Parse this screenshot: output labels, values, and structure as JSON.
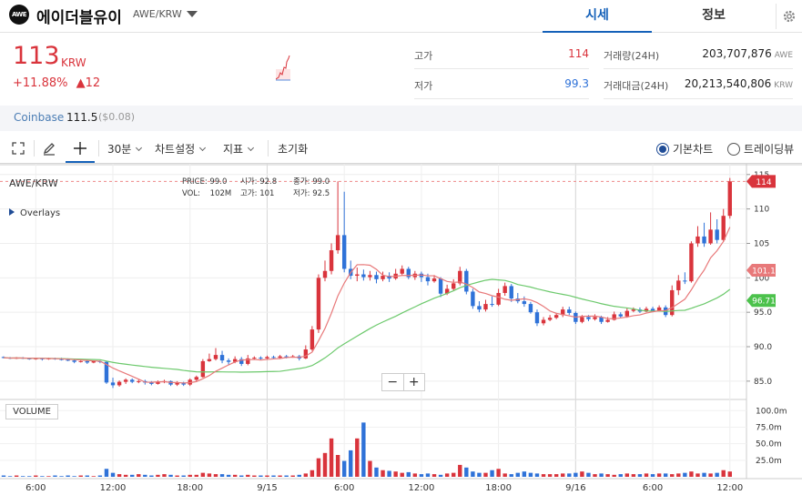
{
  "header": {
    "logo_text": "AWE",
    "coin_name": "에이더블유이",
    "pair": "AWE/KRW",
    "tabs": [
      "시세",
      "정보"
    ]
  },
  "ticker": {
    "price": "113",
    "unit": "KRW",
    "change_pct": "+11.88%",
    "change_abs": "▲12"
  },
  "stats": {
    "high_label": "고가",
    "high": "114",
    "low_label": "저가",
    "low": "99.3",
    "volume_label": "거래량(24H)",
    "volume": "203,707,876",
    "volume_unit": "AWE",
    "amount_label": "거래대금(24H)",
    "amount": "20,213,540,806",
    "amount_unit": "KRW"
  },
  "exchange": {
    "name": "Coinbase",
    "price": "111.5",
    "diff": "($0.08)"
  },
  "toolbar": {
    "interval": "30분",
    "chart_settings": "차트설정",
    "indicators": "지표",
    "reset": "초기화",
    "basic_chart": "기본차트",
    "trading_view": "트레이딩뷰"
  },
  "chart_info": {
    "pair": "AWE/KRW",
    "overlays": "Overlays",
    "price_label": "PRICE:",
    "price_val": "99.0",
    "open_label": "시가:",
    "open_val": "92.8",
    "close_label": "종가:",
    "close_val": "99.0",
    "vol_label": "VOL:",
    "vol_val": "102M",
    "high_label": "고가:",
    "high_val": "101",
    "low_label": "저가:",
    "low_val": "92.5",
    "volume_panel": "VOLUME",
    "zoom_out": "−",
    "zoom_in": "+"
  },
  "colors": {
    "up": "#d9343c",
    "down": "#2f72d8",
    "ma_fast": "#e8797a",
    "ma_slow": "#6cc96c",
    "accent": "#1561b9"
  },
  "chart_data": {
    "type": "candlestick",
    "price_axis": {
      "ticks": [
        85.0,
        90.0,
        95.0,
        100,
        105,
        110,
        115
      ],
      "range": [
        83.0,
        115.5
      ]
    },
    "volume_axis": {
      "ticks": [
        "25.0m",
        "50.0m",
        "75.0m",
        "100.0m"
      ],
      "range": [
        0,
        110
      ]
    },
    "time_ticks": [
      {
        "label": "6:00",
        "i": 5
      },
      {
        "label": "12:00",
        "i": 17
      },
      {
        "label": "18:00",
        "i": 29
      },
      {
        "label": "9/15",
        "i": 41
      },
      {
        "label": "6:00",
        "i": 53
      },
      {
        "label": "12:00",
        "i": 65
      },
      {
        "label": "18:00",
        "i": 77
      },
      {
        "label": "9/16",
        "i": 89
      },
      {
        "label": "6:00",
        "i": 101
      },
      {
        "label": "12:00",
        "i": 113
      }
    ],
    "price_tags": [
      {
        "value": 114,
        "label": "114",
        "color": "#d9343c"
      },
      {
        "value": 101.1,
        "label": "101.1",
        "color": "#e8797a"
      },
      {
        "value": 96.71,
        "label": "96.71",
        "color": "#4cc24c"
      }
    ],
    "candles": [
      [
        88.5,
        88.4,
        88.6,
        88.3
      ],
      [
        88.4,
        88.3,
        88.5,
        88.2
      ],
      [
        88.3,
        88.4,
        88.5,
        88.2
      ],
      [
        88.4,
        88.3,
        88.5,
        88.2
      ],
      [
        88.3,
        88.2,
        88.4,
        88.1
      ],
      [
        88.2,
        88.3,
        88.4,
        88.1
      ],
      [
        88.3,
        88.2,
        88.4,
        88.0
      ],
      [
        88.2,
        88.3,
        88.4,
        88.1
      ],
      [
        88.3,
        88.2,
        88.4,
        88.1
      ],
      [
        88.2,
        88.1,
        88.4,
        88.0
      ],
      [
        88.1,
        88.0,
        88.3,
        87.9
      ],
      [
        88.0,
        87.8,
        88.1,
        87.6
      ],
      [
        87.8,
        87.9,
        88.0,
        87.7
      ],
      [
        87.9,
        87.7,
        88.0,
        87.5
      ],
      [
        87.7,
        87.9,
        88.0,
        87.6
      ],
      [
        87.9,
        87.8,
        88.0,
        87.6
      ],
      [
        87.8,
        84.8,
        87.9,
        84.6
      ],
      [
        84.8,
        84.4,
        85.5,
        84.0
      ],
      [
        84.4,
        84.9,
        85.1,
        84.2
      ],
      [
        84.9,
        85.2,
        85.4,
        84.6
      ],
      [
        85.2,
        84.9,
        85.4,
        84.7
      ],
      [
        84.9,
        85.0,
        85.2,
        84.7
      ],
      [
        85.0,
        84.8,
        85.2,
        84.5
      ],
      [
        84.8,
        84.6,
        85.0,
        84.4
      ],
      [
        84.6,
        84.9,
        85.1,
        84.5
      ],
      [
        84.9,
        85.0,
        85.2,
        84.7
      ],
      [
        85.0,
        84.5,
        85.1,
        84.3
      ],
      [
        84.5,
        84.8,
        85.0,
        84.3
      ],
      [
        84.8,
        84.5,
        84.9,
        84.3
      ],
      [
        84.5,
        85.2,
        85.4,
        84.3
      ],
      [
        85.2,
        85.6,
        85.8,
        85.0
      ],
      [
        85.6,
        87.9,
        88.2,
        85.5
      ],
      [
        87.9,
        88.2,
        89.0,
        87.8
      ],
      [
        88.2,
        88.8,
        89.8,
        88.0
      ],
      [
        88.8,
        88.0,
        89.4,
        87.6
      ],
      [
        88.0,
        87.8,
        88.3,
        87.4
      ],
      [
        87.8,
        88.2,
        88.6,
        87.6
      ],
      [
        88.2,
        87.5,
        88.5,
        87.2
      ],
      [
        87.5,
        88.3,
        88.8,
        87.3
      ],
      [
        88.3,
        88.4,
        88.6,
        88.1
      ],
      [
        88.4,
        88.3,
        88.6,
        88.1
      ],
      [
        88.3,
        88.5,
        88.7,
        88.2
      ],
      [
        88.5,
        88.4,
        88.7,
        88.3
      ],
      [
        88.4,
        88.6,
        88.8,
        88.2
      ],
      [
        88.6,
        88.5,
        88.8,
        88.3
      ],
      [
        88.5,
        88.6,
        88.8,
        88.4
      ],
      [
        88.6,
        88.3,
        88.8,
        88.0
      ],
      [
        88.3,
        89.6,
        90.2,
        88.2
      ],
      [
        89.6,
        92.5,
        93.0,
        89.4
      ],
      [
        92.5,
        100.0,
        100.5,
        92.0
      ],
      [
        100.0,
        101.0,
        102.5,
        99.5
      ],
      [
        101.0,
        104.0,
        105.0,
        100.5
      ],
      [
        104.0,
        106.2,
        114.0,
        103.5
      ],
      [
        106.2,
        101.3,
        112.5,
        100.8
      ],
      [
        101.3,
        100.3,
        102.5,
        99.8
      ],
      [
        100.3,
        100.5,
        101.5,
        99.5
      ],
      [
        100.5,
        100.1,
        101.2,
        99.6
      ],
      [
        100.1,
        100.4,
        101.0,
        99.6
      ],
      [
        100.4,
        99.8,
        100.9,
        99.2
      ],
      [
        99.8,
        100.3,
        100.9,
        99.5
      ],
      [
        100.3,
        99.9,
        100.8,
        99.4
      ],
      [
        99.9,
        100.6,
        101.3,
        99.7
      ],
      [
        100.6,
        101.3,
        101.8,
        100.3
      ],
      [
        101.3,
        100.1,
        101.6,
        99.8
      ],
      [
        100.1,
        100.6,
        101.0,
        99.7
      ],
      [
        100.6,
        100.1,
        100.9,
        99.4
      ],
      [
        100.1,
        99.5,
        100.6,
        98.9
      ],
      [
        99.5,
        99.9,
        100.4,
        99.3
      ],
      [
        99.9,
        97.7,
        100.1,
        97.2
      ],
      [
        97.7,
        98.4,
        99.0,
        97.5
      ],
      [
        98.4,
        99.2,
        99.8,
        98.2
      ],
      [
        99.2,
        101.0,
        101.6,
        98.9
      ],
      [
        101.0,
        98.0,
        101.3,
        97.6
      ],
      [
        98.0,
        95.9,
        98.4,
        95.5
      ],
      [
        95.9,
        95.4,
        96.6,
        95.0
      ],
      [
        95.4,
        96.2,
        96.8,
        95.1
      ],
      [
        96.2,
        96.1,
        97.3,
        95.8
      ],
      [
        96.1,
        97.8,
        98.4,
        95.9
      ],
      [
        97.8,
        98.8,
        99.3,
        97.4
      ],
      [
        98.8,
        97.0,
        99.1,
        96.5
      ],
      [
        97.0,
        96.6,
        97.8,
        96.3
      ],
      [
        96.6,
        96.2,
        97.3,
        95.8
      ],
      [
        96.2,
        95.0,
        96.5,
        94.8
      ],
      [
        95.0,
        93.4,
        95.4,
        93.0
      ],
      [
        93.4,
        93.9,
        94.3,
        93.1
      ],
      [
        93.9,
        94.2,
        94.6,
        93.7
      ],
      [
        94.2,
        94.6,
        94.9,
        94.0
      ],
      [
        94.6,
        95.4,
        95.8,
        94.3
      ],
      [
        95.4,
        94.9,
        95.8,
        94.6
      ],
      [
        94.9,
        93.6,
        95.1,
        93.3
      ],
      [
        93.6,
        94.3,
        94.6,
        93.4
      ],
      [
        94.3,
        94.0,
        94.6,
        93.7
      ],
      [
        94.0,
        94.3,
        94.7,
        93.8
      ],
      [
        94.3,
        93.6,
        94.5,
        93.3
      ],
      [
        93.6,
        93.9,
        94.3,
        93.5
      ],
      [
        93.9,
        94.7,
        95.1,
        93.8
      ],
      [
        94.7,
        94.4,
        95.0,
        94.1
      ],
      [
        94.4,
        95.2,
        95.6,
        94.2
      ],
      [
        95.2,
        95.4,
        95.7,
        95.0
      ],
      [
        95.4,
        95.1,
        95.7,
        94.9
      ],
      [
        95.1,
        95.5,
        95.8,
        95.0
      ],
      [
        95.5,
        95.2,
        95.8,
        95.0
      ],
      [
        95.2,
        95.7,
        96.0,
        95.1
      ],
      [
        95.7,
        94.6,
        96.0,
        94.3
      ],
      [
        94.6,
        98.2,
        98.9,
        94.4
      ],
      [
        98.2,
        99.6,
        100.4,
        97.5
      ],
      [
        99.6,
        99.5,
        100.8,
        99.1
      ],
      [
        99.5,
        105.0,
        105.3,
        99.3
      ],
      [
        105.0,
        106.0,
        107.5,
        104.5
      ],
      [
        106.0,
        105.0,
        108.0,
        104.5
      ],
      [
        105.0,
        107.0,
        109.5,
        104.8
      ],
      [
        107.0,
        105.5,
        108.5,
        105.0
      ],
      [
        105.5,
        109.0,
        110.0,
        105.2
      ],
      [
        109.0,
        114.0,
        114.5,
        108.6
      ]
    ],
    "volumes": [
      2,
      1,
      2,
      1,
      1,
      2,
      1,
      1,
      2,
      1,
      2,
      1,
      2,
      2,
      1,
      2,
      12,
      6,
      4,
      3,
      3,
      4,
      3,
      2,
      3,
      4,
      3,
      2,
      2,
      3,
      3,
      6,
      5,
      4,
      4,
      3,
      3,
      2,
      3,
      2,
      2,
      2,
      2,
      2,
      2,
      2,
      3,
      5,
      10,
      28,
      36,
      58,
      33,
      24,
      40,
      58,
      82,
      24,
      14,
      10,
      9,
      8,
      6,
      7,
      5,
      4,
      5,
      4,
      3,
      5,
      6,
      18,
      14,
      8,
      6,
      6,
      10,
      12,
      5,
      4,
      6,
      8,
      6,
      5,
      4,
      4,
      4,
      5,
      5,
      6,
      8,
      6,
      4,
      5,
      4,
      3,
      4,
      5,
      4,
      4,
      5,
      4,
      5,
      5,
      4,
      5,
      6,
      8,
      5,
      6,
      5,
      6,
      10,
      8
    ]
  }
}
